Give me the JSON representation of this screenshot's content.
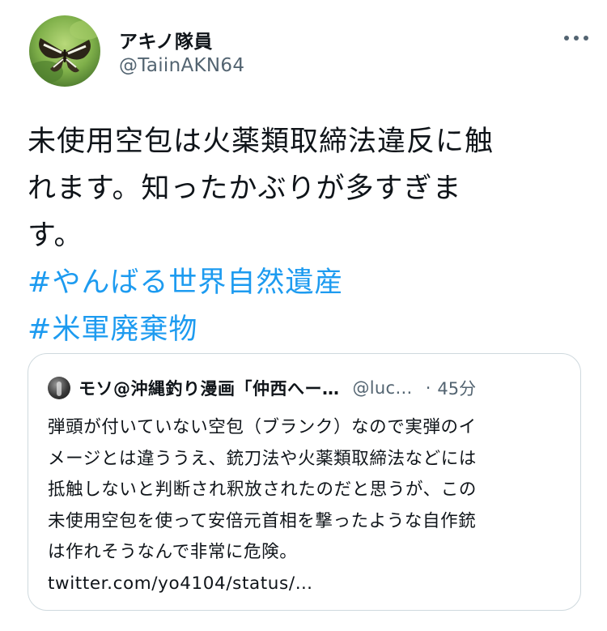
{
  "author": {
    "display_name": "アキノ隊員",
    "handle": "@TaiinAKN64",
    "avatar_icon": "butterfly-avatar"
  },
  "tweet": {
    "text_lines": [
      "未使用空包は火薬類取締法違反に触",
      "れます。知ったかぶりが多すぎま",
      "す。"
    ],
    "hashtags": [
      "#やんばる世界自然遺産",
      "#米軍廃棄物"
    ]
  },
  "quoted": {
    "display_name": "モソ@沖縄釣り漫画「仲西へー…",
    "handle": "@luc…",
    "separator": "·",
    "time": "45分",
    "text_lines": [
      "弾頭が付いていない空包（ブランク）なので実弾のイ",
      "メージとは違ううえ、銃刀法や火薬類取締法などには",
      "抵触しないと判断され釈放されたのだと思うが、この",
      "未使用空包を使って安倍元首相を撃ったような自作銃",
      "は作れそうなんで非常に危険。"
    ],
    "link": "twitter.com/yo4104/status/…"
  },
  "colors": {
    "accent": "#1d9bf0",
    "secondary_text": "#536471",
    "border": "#cfd9de"
  },
  "icons": {
    "more": "more-dots-icon"
  }
}
